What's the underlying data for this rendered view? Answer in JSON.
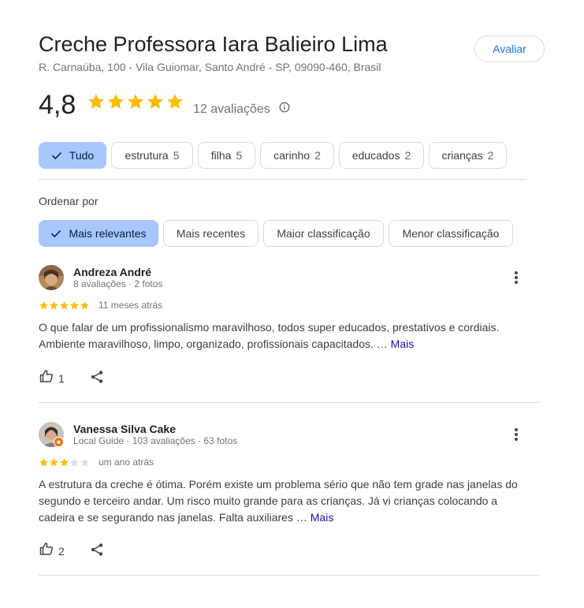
{
  "place": {
    "title": "Creche Professora Iara Balieiro Lima",
    "address": "R. Carnaúba, 100 - Vila Guiomar, Santo André - SP, 09090-460, Brasil",
    "avaliar_label": "Avaliar",
    "rating": "4,8",
    "star_count": 5,
    "review_count_label": "12 avaliações"
  },
  "filters": [
    {
      "label": "Tudo",
      "count": "",
      "selected": true
    },
    {
      "label": "estrutura",
      "count": "5",
      "selected": false
    },
    {
      "label": "filha",
      "count": "5",
      "selected": false
    },
    {
      "label": "carinho",
      "count": "2",
      "selected": false
    },
    {
      "label": "educados",
      "count": "2",
      "selected": false
    },
    {
      "label": "crianças",
      "count": "2",
      "selected": false
    }
  ],
  "sort": {
    "label": "Ordenar por",
    "options": [
      {
        "label": "Mais relevantes",
        "selected": true
      },
      {
        "label": "Mais recentes",
        "selected": false
      },
      {
        "label": "Maior classificação",
        "selected": false
      },
      {
        "label": "Menor classificação",
        "selected": false
      }
    ]
  },
  "reviews": [
    {
      "name": "Andreza André",
      "meta": "8 avaliações · 2 fotos",
      "stars": 5,
      "time": "11 meses atrás",
      "text": "O que falar de um profissionalismo maravilhoso, todos super educados, prestativos e cordiais. Ambiente maravilhoso, limpo, organizado, profissionais capacitados. …",
      "more_label": "Mais",
      "likes": "1"
    },
    {
      "name": "Vanessa Silva Cake",
      "meta": "Local Guide · 103 avaliações · 63 fotos",
      "stars": 3,
      "time": "um ano atrás",
      "text": "A estrutura da creche é ótima. Porém existe um problema sério que não tem grade nas janelas do segundo e terceiro andar. Um risco muito grande para as crianças. Já vi crianças colocando a cadeira e se segurando nas janelas. Falta auxiliares …",
      "more_label": "Mais",
      "likes": "2"
    }
  ],
  "colors": {
    "star_filled": "#fbbc04",
    "star_empty": "#dadce0",
    "chip_selected_bg": "#a8c7fa",
    "link_blue": "#1a73e8",
    "more_link": "#1a0dab"
  }
}
